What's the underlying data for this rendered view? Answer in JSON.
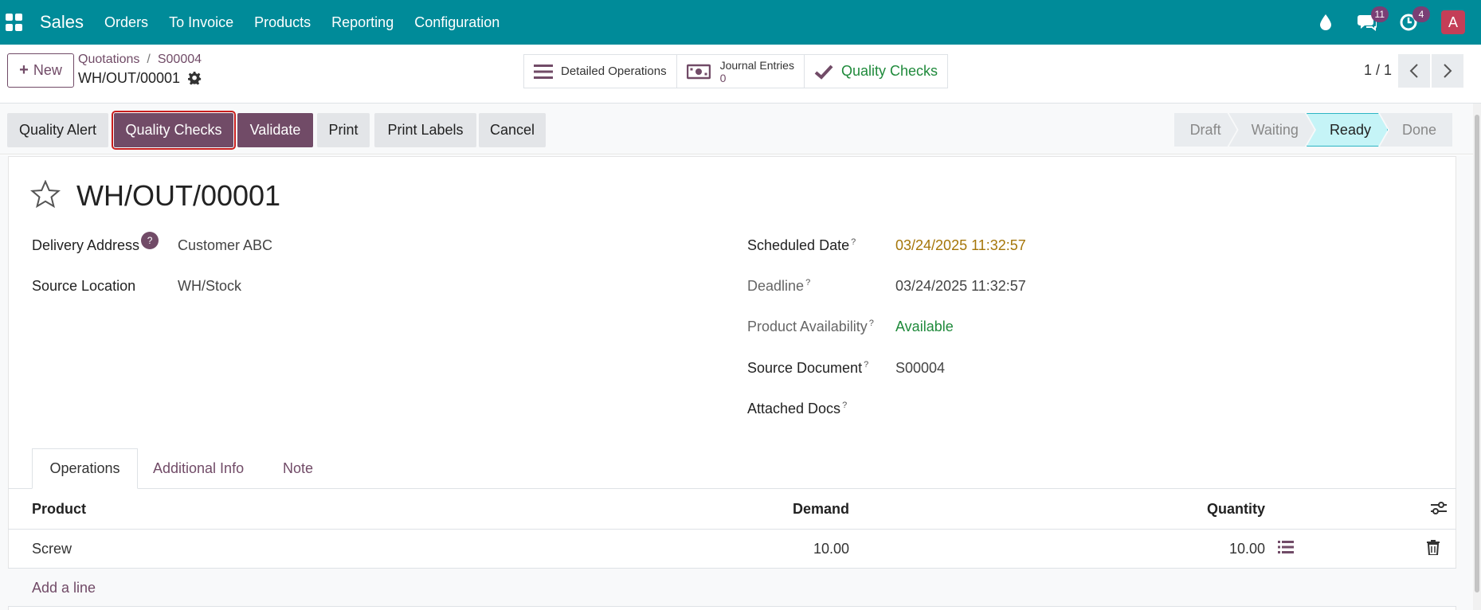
{
  "navbar": {
    "brand": "Sales",
    "menu": [
      "Orders",
      "To Invoice",
      "Products",
      "Reporting",
      "Configuration"
    ],
    "messages_count": "11",
    "activities_count": "4",
    "avatar_letter": "A"
  },
  "control": {
    "new_label": "New",
    "breadcrumb_parent": "Quotations",
    "breadcrumb_current": "S00004",
    "record_name": "WH/OUT/00001",
    "smart_detailed": "Detailed Operations",
    "smart_journal_title": "Journal Entries",
    "smart_journal_value": "0",
    "smart_quality": "Quality Checks",
    "pager": "1 / 1"
  },
  "actions": {
    "quality_alert": "Quality Alert",
    "quality_checks": "Quality Checks",
    "validate": "Validate",
    "print": "Print",
    "print_labels": "Print Labels",
    "cancel": "Cancel"
  },
  "status": {
    "steps": [
      "Draft",
      "Waiting",
      "Ready",
      "Done"
    ],
    "active": "Ready"
  },
  "form": {
    "title": "WH/OUT/00001",
    "delivery_address_label": "Delivery Address",
    "delivery_address_help": "?",
    "delivery_address": "Customer ABC",
    "source_location_label": "Source Location",
    "source_location": "WH/Stock",
    "scheduled_date_label": "Scheduled Date",
    "scheduled_date": "03/24/2025 11:32:57",
    "deadline_label": "Deadline",
    "deadline": "03/24/2025 11:32:57",
    "availability_label": "Product Availability",
    "availability": "Available",
    "source_document_label": "Source Document",
    "source_document": "S00004",
    "attached_docs_label": "Attached Docs",
    "help_mark": "?"
  },
  "tabs": [
    "Operations",
    "Additional Info",
    "Note"
  ],
  "table": {
    "headers": {
      "product": "Product",
      "demand": "Demand",
      "quantity": "Quantity"
    },
    "rows": [
      {
        "product": "Screw",
        "demand": "10.00",
        "quantity": "10.00"
      }
    ],
    "add_line": "Add a line"
  },
  "colors": {
    "navbar": "#008b99",
    "primary": "#714b67",
    "ready": "#c5f4f7",
    "date_highlight": "#a5760a",
    "available": "#1f8a3b"
  }
}
